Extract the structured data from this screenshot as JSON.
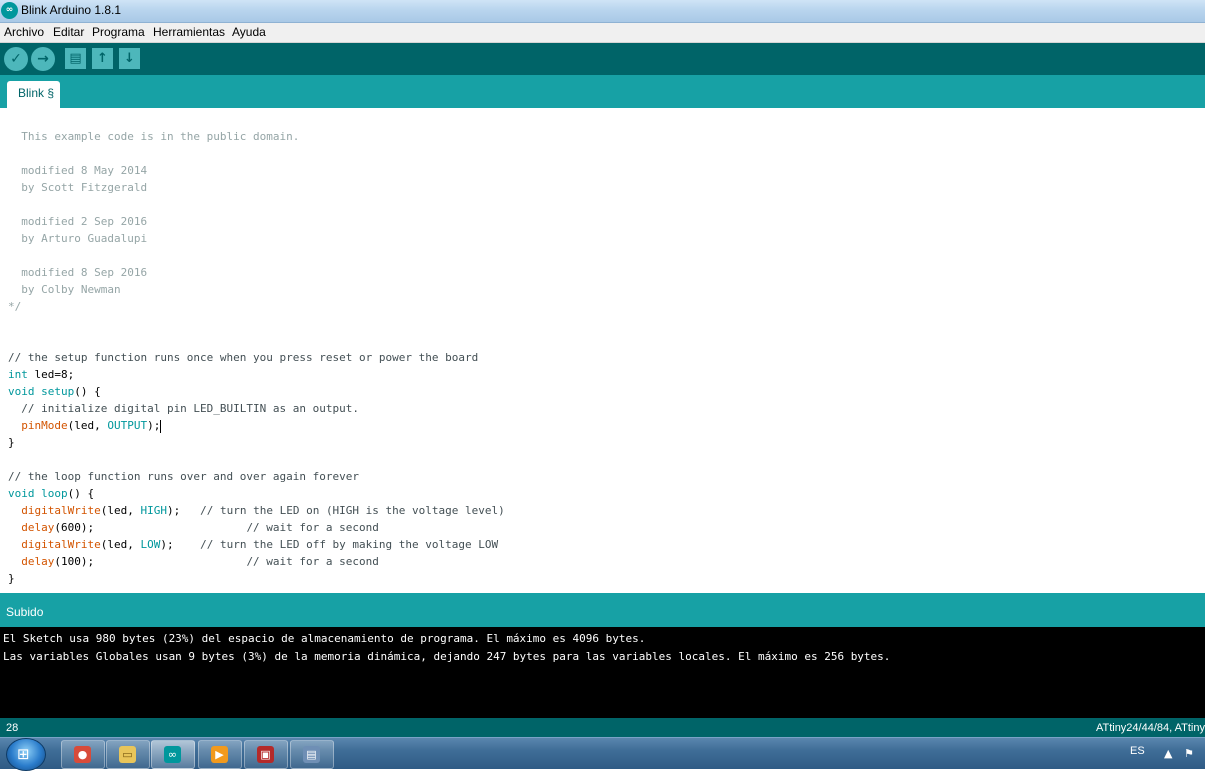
{
  "window": {
    "title": "Blink Arduino 1.8.1",
    "logo_glyph": "∞"
  },
  "menu": [
    "Archivo",
    "Editar",
    "Programa",
    "Herramientas",
    "Ayuda"
  ],
  "toolbar": {
    "verify_glyph": "✓",
    "upload_glyph": "→",
    "new_glyph": "▤",
    "open_glyph": "↑",
    "save_glyph": "↓"
  },
  "tabs": [
    {
      "label": "Blink §"
    }
  ],
  "editor": {
    "comment_lines": [
      "  This example code is in the public domain.",
      "",
      "  modified 8 May 2014",
      "  by Scott Fitzgerald",
      "",
      "  modified 2 Sep 2016",
      "  by Arturo Guadalupi",
      "",
      "  modified 8 Sep 2016",
      "  by Colby Newman",
      "*/"
    ],
    "code": {
      "setup_comment": "// the setup function runs once when you press reset or power the board",
      "int_kw": "int",
      "int_rest": " led=8;",
      "void1": "void",
      "setup_name": "setup",
      "setup_rest": "() {",
      "init_comment": "  // initialize digital pin LED_BUILTIN as an output.",
      "pinmode_fn": "pinMode",
      "pinmode_args": "(led, ",
      "output_kw": "OUTPUT",
      "pinmode_end": ");",
      "close1": "}",
      "loop_comment": "// the loop function runs over and over again forever",
      "void2": "void",
      "loop_name": "loop",
      "loop_rest": "() {",
      "dw1_fn": "digitalWrite",
      "dw1_args": "(led, ",
      "high_kw": "HIGH",
      "dw1_end": ");   ",
      "dw1_comment": "// turn the LED on (HIGH is the voltage level)",
      "delay1_fn": "delay",
      "delay1_args": "(600);                       ",
      "delay1_comment": "// wait for a second",
      "dw2_fn": "digitalWrite",
      "dw2_args": "(led, ",
      "low_kw": "LOW",
      "dw2_end": ");    ",
      "dw2_comment": "// turn the LED off by making the voltage LOW",
      "delay2_fn": "delay",
      "delay2_args": "(100);                       ",
      "delay2_comment": "// wait for a second",
      "close2": "}"
    }
  },
  "status": {
    "message": "Subido"
  },
  "console": {
    "lines": [
      "El Sketch usa 980 bytes (23%) del espacio de almacenamiento de programa. El máximo es 4096 bytes.",
      "Las variables Globales usan 9 bytes (3%) de la memoria dinámica, dejando 247 bytes para las variables locales. El máximo es 256 bytes."
    ]
  },
  "footer": {
    "line_number": "28",
    "board": "ATtiny24/44/84, ATtiny"
  },
  "taskbar": {
    "start_glyph": "⊞",
    "apps": [
      {
        "name": "chrome",
        "glyph": "●"
      },
      {
        "name": "explorer",
        "glyph": "▭"
      },
      {
        "name": "arduino",
        "glyph": "∞"
      },
      {
        "name": "media-player",
        "glyph": "▶"
      },
      {
        "name": "toolbox",
        "glyph": "▣"
      },
      {
        "name": "document",
        "glyph": "▤"
      }
    ],
    "language": "ES",
    "tray_up": "▲",
    "tray_flag": "⚑"
  },
  "colors": {
    "teal_dark": "#006468",
    "teal": "#17a1a5",
    "keyword": "#00979c",
    "function": "#d35400",
    "comment": "#95a5a6"
  }
}
